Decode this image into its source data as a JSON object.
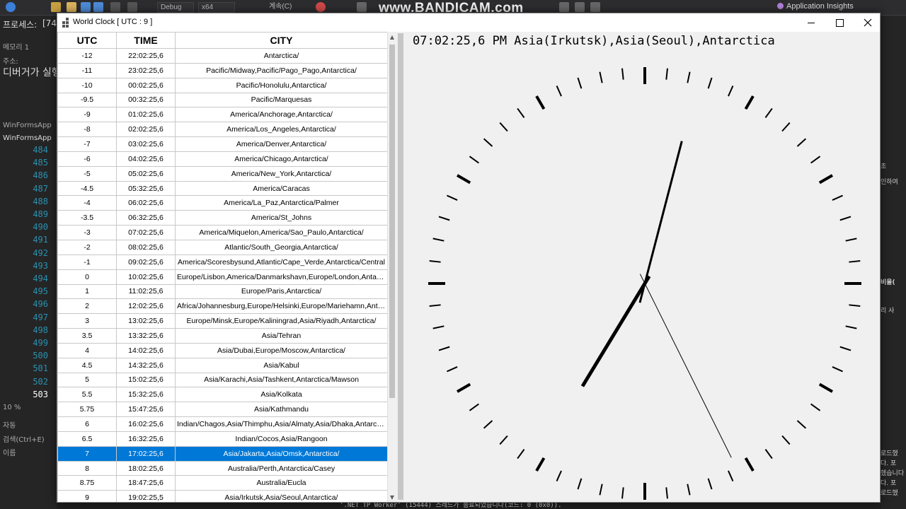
{
  "ide": {
    "watermark": "www.BANDICAM.com",
    "config_combo": "Debug",
    "platform_combo": "x64",
    "continue_label": "계속(C)",
    "app_insights": "Application Insights",
    "left_labels": [
      "프로세스:",
      "[74",
      "메모리 1",
      "주소:",
      "디버거가 실행",
      "WinFormsApp",
      "WinFormsApp",
      "10 %",
      "자동",
      "검색(Ctrl+E)",
      "이름"
    ],
    "line_numbers": [
      "484",
      "485",
      "486",
      "487",
      "488",
      "489",
      "490",
      "491",
      "492",
      "493",
      "494",
      "495",
      "496",
      "497",
      "498",
      "499",
      "500",
      "501",
      "502",
      "503"
    ],
    "right_labels": [
      "초",
      "인하여",
      "비율(",
      "리 사",
      "로드헸",
      "다. 포",
      "헸습니다",
      "다. 포",
      "로드헸"
    ],
    "output_text": "'.NET TP Worker' (15444) 스레드가 종료되었습니다(코드: 0 (0x0))."
  },
  "window": {
    "title": "World Clock [ UTC : 9 ]"
  },
  "grid": {
    "headers": [
      "UTC",
      "TIME",
      "CITY"
    ],
    "selected_index": 27,
    "rows": [
      [
        "-12",
        "22:02:25,6",
        "Antarctica/"
      ],
      [
        "-11",
        "23:02:25,6",
        "Pacific/Midway,Pacific/Pago_Pago,Antarctica/"
      ],
      [
        "-10",
        "00:02:25,6",
        "Pacific/Honolulu,Antarctica/"
      ],
      [
        "-9.5",
        "00:32:25,6",
        "Pacific/Marquesas"
      ],
      [
        "-9",
        "01:02:25,6",
        "America/Anchorage,Antarctica/"
      ],
      [
        "-8",
        "02:02:25,6",
        "America/Los_Angeles,Antarctica/"
      ],
      [
        "-7",
        "03:02:25,6",
        "America/Denver,Antarctica/"
      ],
      [
        "-6",
        "04:02:25,6",
        "America/Chicago,Antarctica/"
      ],
      [
        "-5",
        "05:02:25,6",
        "America/New_York,Antarctica/"
      ],
      [
        "-4.5",
        "05:32:25,6",
        "America/Caracas"
      ],
      [
        "-4",
        "06:02:25,6",
        "America/La_Paz,Antarctica/Palmer"
      ],
      [
        "-3.5",
        "06:32:25,6",
        "America/St_Johns"
      ],
      [
        "-3",
        "07:02:25,6",
        "America/Miquelon,America/Sao_Paulo,Antarctica/"
      ],
      [
        "-2",
        "08:02:25,6",
        "Atlantic/South_Georgia,Antarctica/"
      ],
      [
        "-1",
        "09:02:25,6",
        "America/Scoresbysund,Atlantic/Cape_Verde,Antarctica/Central"
      ],
      [
        "0",
        "10:02:25,6",
        "Europe/Lisbon,America/Danmarkshavn,Europe/London,Antarcti..."
      ],
      [
        "1",
        "11:02:25,6",
        "Europe/Paris,Antarctica/"
      ],
      [
        "2",
        "12:02:25,6",
        "Africa/Johannesburg,Europe/Helsinki,Europe/Mariehamn,Antarc..."
      ],
      [
        "3",
        "13:02:25,6",
        "Europe/Minsk,Europe/Kaliningrad,Asia/Riyadh,Antarctica/"
      ],
      [
        "3.5",
        "13:32:25,6",
        "Asia/Tehran"
      ],
      [
        "4",
        "14:02:25,6",
        "Asia/Dubai,Europe/Moscow,Antarctica/"
      ],
      [
        "4.5",
        "14:32:25,6",
        "Asia/Kabul"
      ],
      [
        "5",
        "15:02:25,6",
        "Asia/Karachi,Asia/Tashkent,Antarctica/Mawson"
      ],
      [
        "5.5",
        "15:32:25,6",
        "Asia/Kolkata"
      ],
      [
        "5.75",
        "15:47:25,6",
        "Asia/Kathmandu"
      ],
      [
        "6",
        "16:02:25,6",
        "Indian/Chagos,Asia/Thimphu,Asia/Almaty,Asia/Dhaka,Antarctic..."
      ],
      [
        "6.5",
        "16:32:25,6",
        "Indian/Cocos,Asia/Rangoon"
      ],
      [
        "7",
        "17:02:25,6",
        "Asia/Jakarta,Asia/Omsk,Antarctica/"
      ],
      [
        "8",
        "18:02:25,6",
        "Australia/Perth,Antarctica/Casey"
      ],
      [
        "8.75",
        "18:47:25,6",
        "Australia/Eucla"
      ],
      [
        "9",
        "19:02:25,5",
        "Asia/Irkutsk,Asia/Seoul,Antarctica/"
      ]
    ]
  },
  "clock": {
    "label": "07:02:25,6 PM Asia(Irkutsk),Asia(Seoul),Antarctica",
    "hours": 7,
    "minutes": 2,
    "seconds": 25.6
  },
  "colors": {
    "selection": "#0078d7",
    "ide_background": "#1e1e1e",
    "clock_background": "#f0f0f0"
  }
}
